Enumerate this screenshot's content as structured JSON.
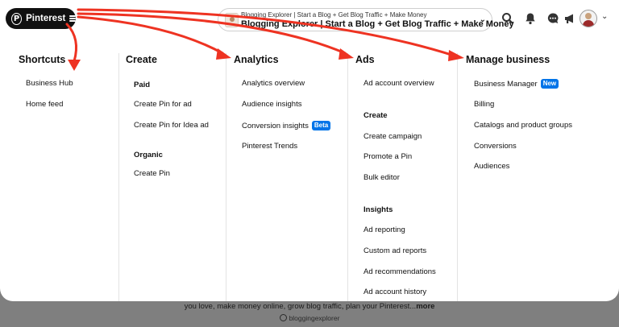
{
  "header": {
    "brand_label": "Pinterest",
    "board": {
      "subtitle": "Blogging Explorer | Start a Blog + Get Blog Traffic + Make Money",
      "title": "Blogging Explorer | Start a Blog + Get Blog Traffic + Make Money"
    },
    "icons": [
      "search-icon",
      "bell-icon",
      "chat-icon",
      "megaphone-icon",
      "avatar",
      "chevron-down-icon"
    ]
  },
  "menu": {
    "shortcuts": {
      "title": "Shortcuts",
      "items": [
        "Business Hub",
        "Home feed"
      ]
    },
    "create": {
      "title": "Create",
      "paid_heading": "Paid",
      "paid_items": [
        "Create Pin for ad",
        "Create Pin for Idea ad"
      ],
      "organic_heading": "Organic",
      "organic_items": [
        "Create Pin"
      ]
    },
    "analytics": {
      "title": "Analytics",
      "items": [
        "Analytics overview",
        "Audience insights",
        "Conversion insights",
        "Pinterest Trends"
      ],
      "beta_badge": "Beta"
    },
    "ads": {
      "title": "Ads",
      "items": [
        "Ad account overview"
      ],
      "create_heading": "Create",
      "create_items": [
        "Create campaign",
        "Promote a Pin",
        "Bulk editor"
      ],
      "insights_heading": "Insights",
      "insights_items": [
        "Ad reporting",
        "Custom ad reports",
        "Ad recommendations",
        "Ad account history"
      ]
    },
    "manage": {
      "title": "Manage business",
      "items": [
        "Business Manager",
        "Billing",
        "Catalogs and product groups",
        "Conversions",
        "Audiences"
      ],
      "new_badge": "New"
    }
  },
  "background": {
    "description_text": "you love, make money online, grow blog traffic, plan your Pinterest...",
    "more_link": "more",
    "profile_handle": "bloggingexplorer"
  },
  "colors": {
    "annotation_arrow": "#ee3322",
    "badge_blue": "#0074e8",
    "brand_black": "#111111"
  }
}
